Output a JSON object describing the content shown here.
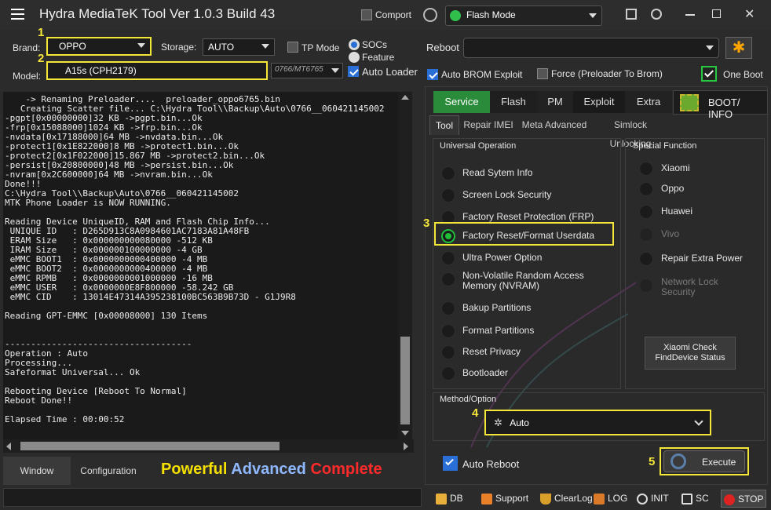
{
  "title": "Hydra MediaTeK Tool  Ver 1.0.3 Build 43",
  "titlebar": {
    "comport_label": "Comport",
    "mode_value": "Flash Mode"
  },
  "top": {
    "brand_label": "Brand:",
    "brand_value": "OPPO",
    "storage_label": "Storage:",
    "storage_value": "AUTO",
    "tp_mode_label": "TP Mode",
    "socs_label": "SOCs",
    "feature_label": "Feature",
    "model_label": "Model:",
    "model_value": "A15s (CPH2179)",
    "chip_value": "0766/MT6765",
    "auto_loader_label": "Auto Loader",
    "reboot_label": "Reboot",
    "auto_brom_label": "Auto BROM Exploit",
    "force_label": "Force (Preloader To Brom)",
    "one_boot_label": "One Boot"
  },
  "markers": {
    "m1": "1",
    "m2": "2",
    "m3": "3",
    "m4": "4",
    "m5": "5"
  },
  "console_lines": [
    "    -> Renaming Preloader....  preloader_oppo6765.bin",
    "   Creating Scatter file... C:\\Hydra Tool\\\\Backup\\Auto\\0766__060421145002",
    "-pgpt[0x00000000]32 KB ->pgpt.bin...Ok",
    "-frp[0x15088000]1024 KB ->frp.bin...Ok",
    "-nvdata[0x17188000]64 MB ->nvdata.bin...Ok",
    "-protect1[0x1E822000]8 MB ->protect1.bin...Ok",
    "-protect2[0x1F022000]15.867 MB ->protect2.bin...Ok",
    "-persist[0x20800000]48 MB ->persist.bin...Ok",
    "-nvram[0x2C600000]64 MB ->nvram.bin...Ok",
    "Done!!!",
    "C:\\Hydra Tool\\\\Backup\\Auto\\0766__060421145002",
    "MTK Phone Loader is NOW RUNNING.",
    "",
    "Reading Device UniqueID, RAM and Flash Chip Info...",
    " UNIQUE ID   : D265D913C8A0984601AC7183A81A48FB",
    " ERAM Size   : 0x000000000080000 -512 KB",
    " IRAM Size   : 0x000000100000000 -4 GB",
    " eMMC BOOT1  : 0x0000000000400000 -4 MB",
    " eMMC BOOT2  : 0x0000000000400000 -4 MB",
    " eMMC RPMB   : 0x0000000001000000 -16 MB",
    " eMMC USER   : 0x0000000E8F800000 -58.242 GB",
    " eMMC CID    : 13014E47314A395238100BC563B9B73D - G1J9R8",
    "",
    "Reading GPT-EMMC [0x00008000] 130 Items",
    "",
    "",
    "------------------------------------",
    "Operation : Auto",
    "Processing...",
    "Safeformat Universal... Ok",
    "",
    "Rebooting Device [Reboot To Normal]",
    "Reboot Done!!",
    "",
    "Elapsed Time : 00:00:52"
  ],
  "bottom_left": {
    "window_tab": "Window",
    "config_tab": "Configuration",
    "slogan_1": "Powerful",
    "slogan_2": "Advanced",
    "slogan_3": "Complete"
  },
  "main_tabs": [
    "Service",
    "Flash",
    "PM",
    "Exploit",
    "Extra"
  ],
  "boot_info_label": "BOOT/ INFO",
  "sub_tabs": [
    "Tool",
    "Repair IMEI",
    "Meta Advanced",
    "Simlock Unlocking"
  ],
  "universal": {
    "header": "Universal Operation",
    "options": [
      "Read Sytem Info",
      "Screen Lock Security",
      "Factory Reset Protection (FRP)",
      "Factory Reset/Format Userdata",
      "Ultra Power Option",
      "Non-Volatile Random Access\nMemory (NVRAM)",
      "Bakup Partitions",
      "Format Partitions",
      "Reset Privacy",
      "Bootloader"
    ]
  },
  "special": {
    "header": "Special Function",
    "options": [
      "Xiaomi",
      "Oppo",
      "Huawei",
      "Vivo",
      "Repair Extra Power",
      "Network Lock\nSecurity"
    ],
    "xiaomi_check": "Xiaomi Check\nFindDevice Status"
  },
  "method": {
    "header": "Method/Option",
    "value": "Auto"
  },
  "auto_reboot_label": "Auto Reboot",
  "execute_label": "Execute",
  "statusbar": [
    "DB",
    "Support",
    "ClearLog",
    "LOG",
    "INIT",
    "SC",
    "STOP"
  ],
  "colors": {
    "accent_green": "#2a8c3a",
    "highlight_yellow": "#f5e63a",
    "slogan_yellow": "#f5e000",
    "slogan_blue": "#8fb8ff",
    "slogan_red": "#ff2a2a"
  }
}
